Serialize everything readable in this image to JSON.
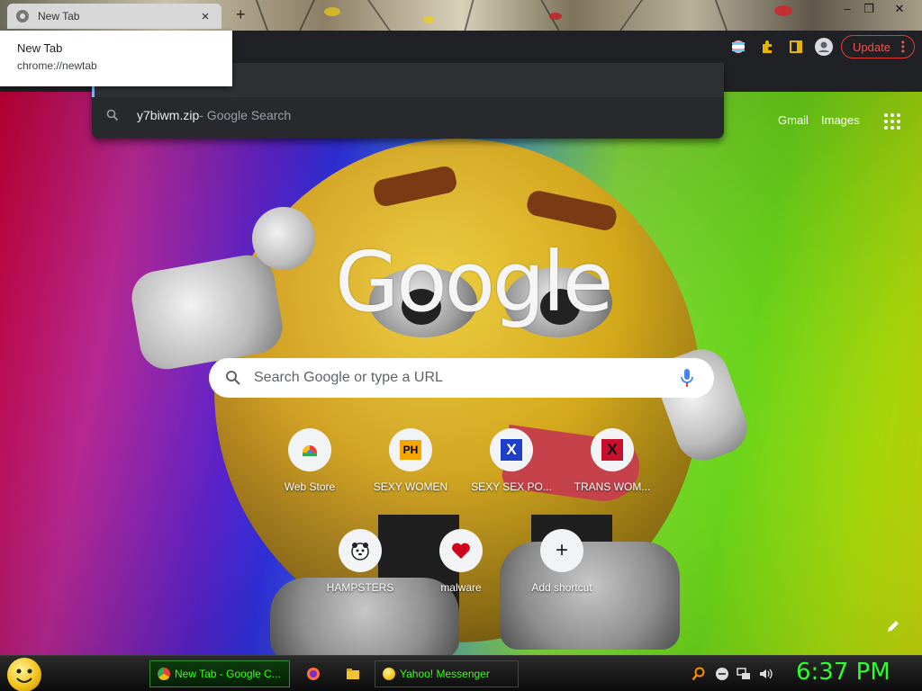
{
  "window": {
    "tab_title": "New Tab",
    "tab_close": "×",
    "new_tab_symbol": "+",
    "controls": [
      "–",
      "❐",
      "✕"
    ]
  },
  "hover_card": {
    "title": "New Tab",
    "url": "chrome://newtab"
  },
  "toolbar": {
    "update_label": "Update",
    "icons": [
      "profile-flag-icon",
      "extensions-icon",
      "side-panel-icon",
      "avatar-icon"
    ]
  },
  "omnibox": {
    "suggestion_query": "y7biwm.zip",
    "suggestion_suffix": " - Google Search"
  },
  "ntp": {
    "gmail": "Gmail",
    "images": "Images",
    "logo": "Google",
    "search_placeholder": "Search Google or type a URL",
    "shortcuts": [
      {
        "label": "Web Store",
        "icon": "web-store-icon"
      },
      {
        "label": "SEXY WOMEN",
        "icon": "ph-icon",
        "badge": "PH"
      },
      {
        "label": "SEXY SEX PO...",
        "icon": "x-blue-icon",
        "badge": "X"
      },
      {
        "label": "TRANS WOM...",
        "icon": "x-red-icon",
        "badge": "X"
      },
      {
        "label": "HAMPSTERS",
        "icon": "hamster-icon"
      },
      {
        "label": "malware",
        "icon": "heart-icon"
      },
      {
        "label": "Add shortcut",
        "icon": "plus-icon",
        "badge": "+"
      }
    ]
  },
  "taskbar": {
    "tasks": [
      {
        "label": "New Tab - Google C...",
        "active": true
      },
      {
        "label": "Yahoo! Messenger",
        "active": false
      }
    ],
    "clock": "6:37 PM"
  },
  "colors": {
    "update_red": "#ef5350",
    "taskbar_text": "#39ff14",
    "clock": "#2bff2b"
  }
}
